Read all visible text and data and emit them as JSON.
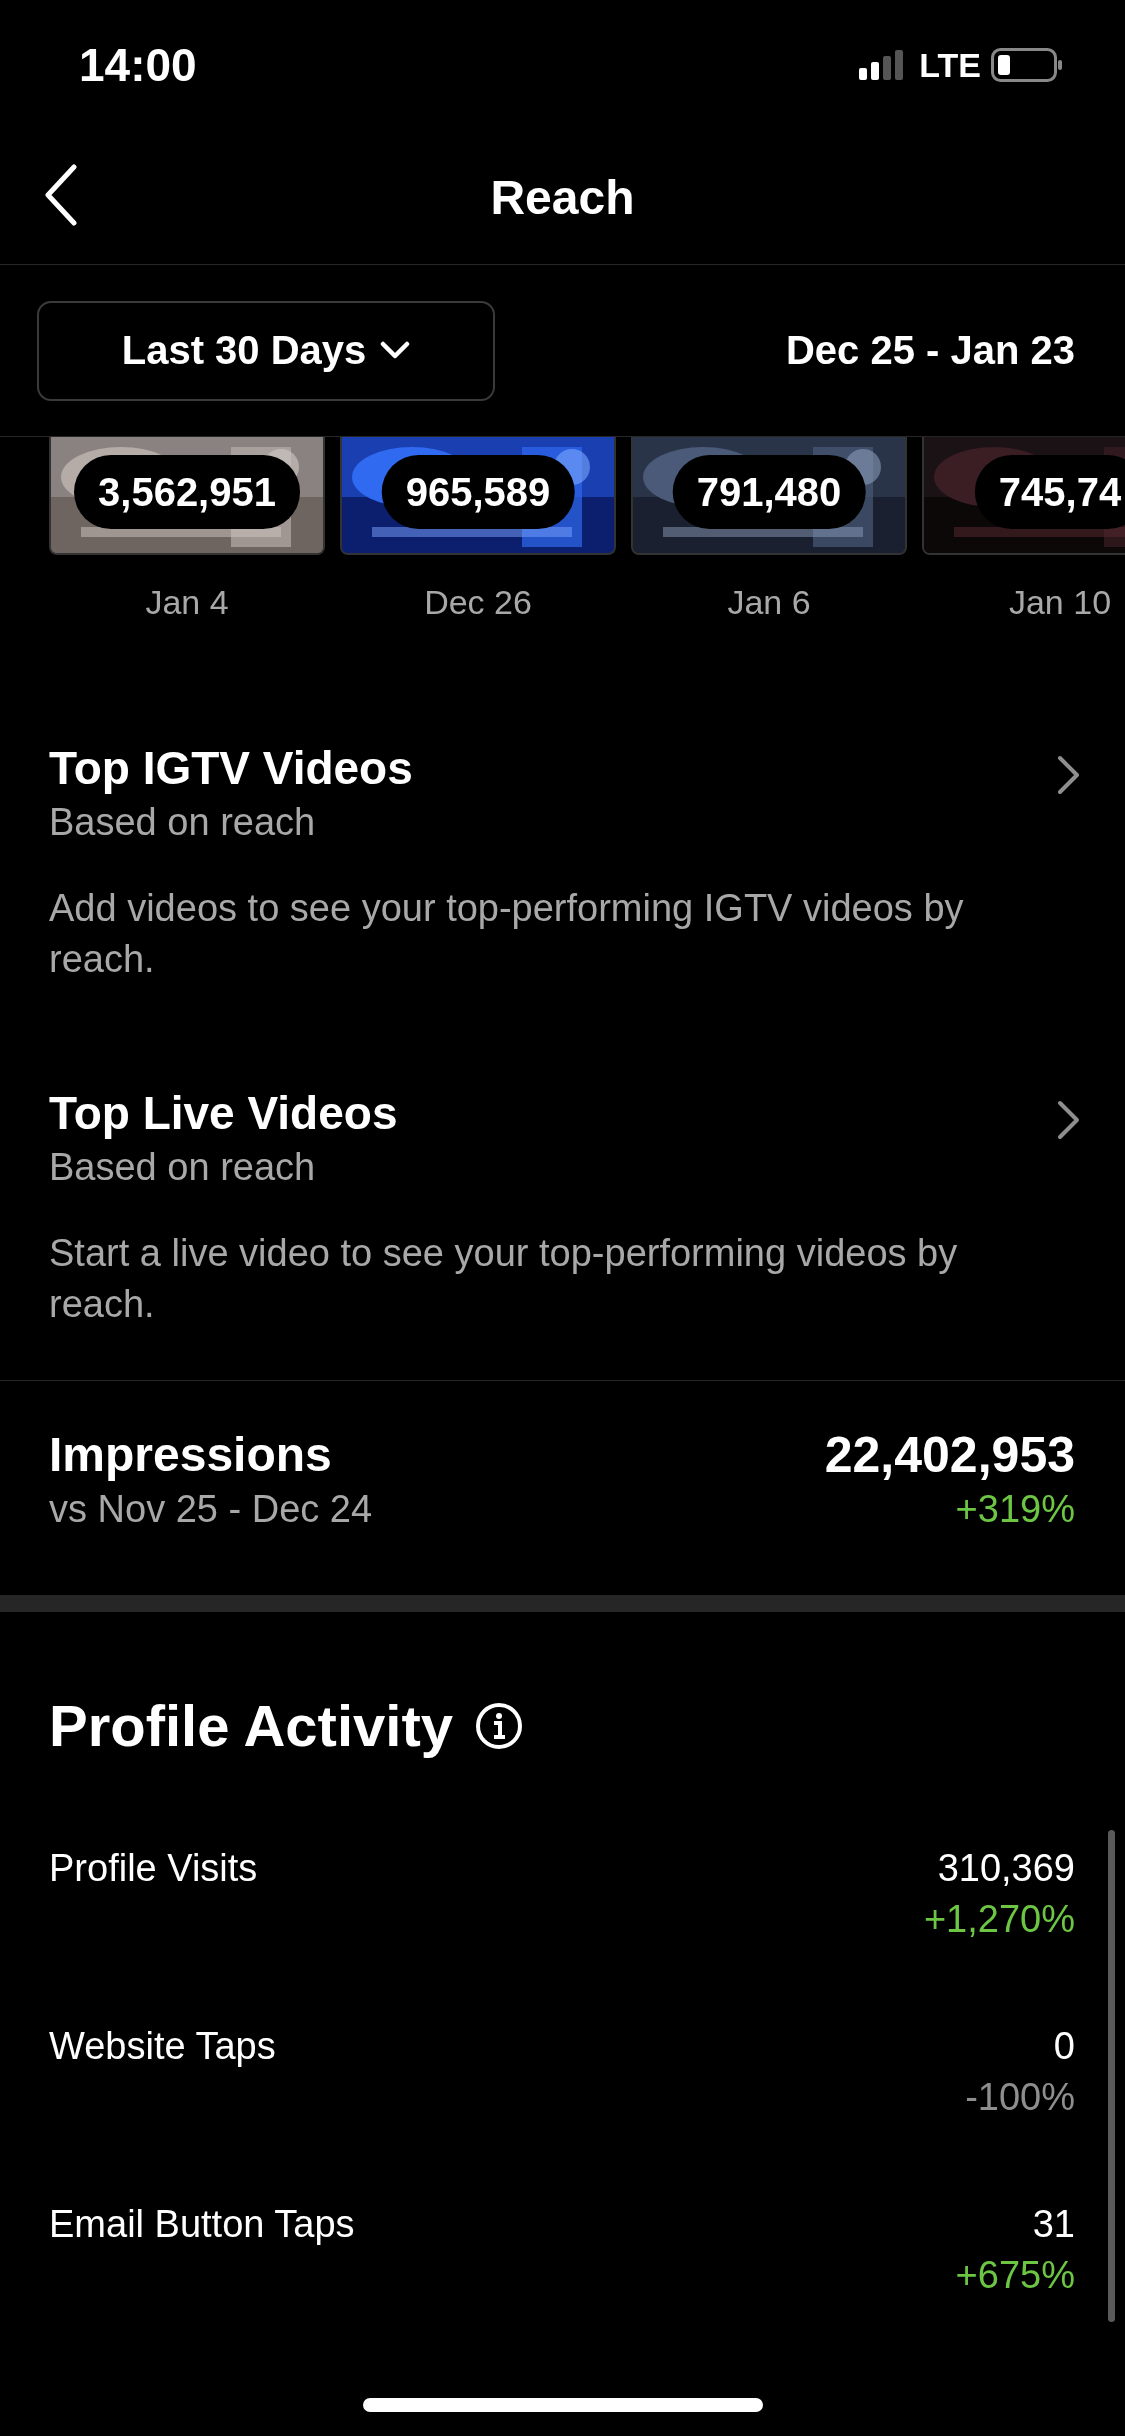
{
  "status_bar": {
    "time": "14:00",
    "network": "LTE"
  },
  "nav": {
    "title": "Reach"
  },
  "filter": {
    "range_label": "Last 30 Days",
    "date_range": "Dec 25 - Jan 23"
  },
  "top_posts": [
    {
      "count": "3,562,951",
      "date": "Jan 4"
    },
    {
      "count": "965,589",
      "date": "Dec 26"
    },
    {
      "count": "791,480",
      "date": "Jan 6"
    },
    {
      "count": "745,74",
      "date": "Jan 10"
    }
  ],
  "sections": [
    {
      "title": "Top IGTV Videos",
      "subtitle": "Based on reach",
      "description": "Add videos to see your top-performing IGTV videos by reach."
    },
    {
      "title": "Top Live Videos",
      "subtitle": "Based on reach",
      "description": "Start a live video to see your top-performing videos by reach."
    }
  ],
  "impressions": {
    "title": "Impressions",
    "comparison": "vs Nov 25 - Dec 24",
    "value": "22,402,953",
    "change": "+319%",
    "color": "#6cc644"
  },
  "profile_activity": {
    "title": "Profile Activity",
    "rows": [
      {
        "label": "Profile Visits",
        "value": "310,369",
        "change": "+1,270%",
        "color": "#6cc644"
      },
      {
        "label": "Website Taps",
        "value": "0",
        "change": "-100%",
        "color": "#8e8e8e"
      },
      {
        "label": "Email Button Taps",
        "value": "31",
        "change": "+675%",
        "color": "#6cc644"
      }
    ]
  }
}
